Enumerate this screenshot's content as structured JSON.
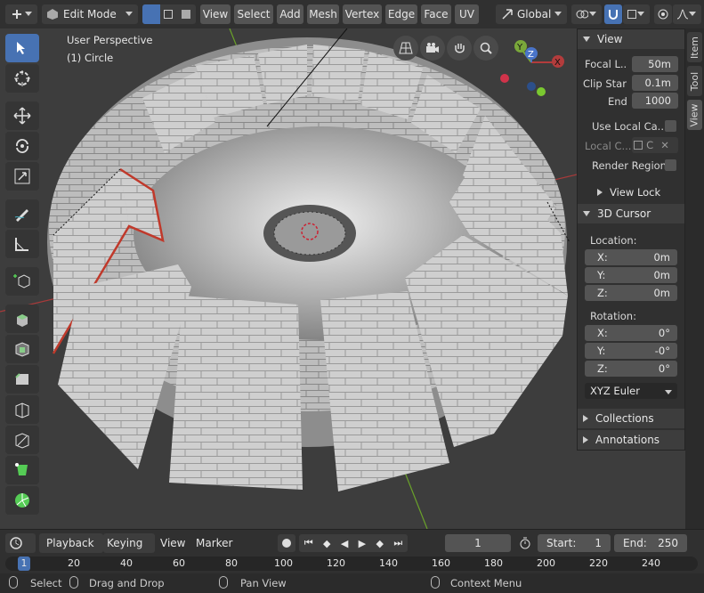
{
  "header": {
    "mode": "Edit Mode",
    "menus": [
      "View",
      "Select",
      "Add",
      "Mesh",
      "Vertex",
      "Edge",
      "Face",
      "UV"
    ],
    "orientation": "Global"
  },
  "viewport": {
    "overlay_line1": "User Perspective",
    "overlay_line2": "(1) Circle",
    "gizmo": {
      "y": "Y",
      "z": "Z",
      "x": "X"
    }
  },
  "toolbar": {
    "tools": [
      "select-box-icon",
      "cursor-icon",
      "move-icon",
      "rotate-icon",
      "scale-icon",
      "annotate-icon",
      "measure-icon",
      "add-cube-icon",
      "extrude-icon",
      "inset-icon",
      "bevel-icon",
      "loop-cut-icon",
      "knife-icon",
      "poly-build-icon",
      "spin-icon"
    ]
  },
  "sidebar": {
    "tabs": [
      "Item",
      "Tool",
      "View"
    ],
    "view_section": "View",
    "focal_label": "Focal L..",
    "focal_value": "50m",
    "clip_start_label": "Clip Star",
    "clip_start_value": "0.1m",
    "clip_end_label": "End",
    "clip_end_value": "1000",
    "use_local_label": "Use Local Ca..",
    "local_camera_label": "Local C...",
    "local_camera_value": "C",
    "render_region_label": "Render Region",
    "view_lock_label": "View Lock",
    "cursor_section": "3D Cursor",
    "location_label": "Location:",
    "loc_x_label": "X:",
    "loc_x": "0m",
    "loc_y_label": "Y:",
    "loc_y": "0m",
    "loc_z_label": "Z:",
    "loc_z": "0m",
    "rotation_label": "Rotation:",
    "rot_x_label": "X:",
    "rot_x": "0°",
    "rot_y_label": "Y:",
    "rot_y": "-0°",
    "rot_z_label": "Z:",
    "rot_z": "0°",
    "rotation_mode": "XYZ Euler",
    "collections_label": "Collections",
    "annotations_label": "Annotations"
  },
  "timeline": {
    "playback": "Playback",
    "keying": "Keying",
    "view": "View",
    "marker": "Marker",
    "current_frame": "1",
    "start_label": "Start:",
    "start_value": "1",
    "end_label": "End:",
    "end_value": "250",
    "ruler": [
      "1",
      "20",
      "40",
      "60",
      "80",
      "100",
      "120",
      "140",
      "160",
      "180",
      "200",
      "220",
      "240"
    ]
  },
  "statusbar": {
    "select": "Select",
    "drag": "Drag and Drop",
    "pan": "Pan View",
    "context": "Context Menu"
  },
  "colors": {
    "accent": "#4772b3",
    "selected_edge": "#c0392b",
    "axis_x": "#b33c3c",
    "axis_y": "#6aa22a"
  }
}
